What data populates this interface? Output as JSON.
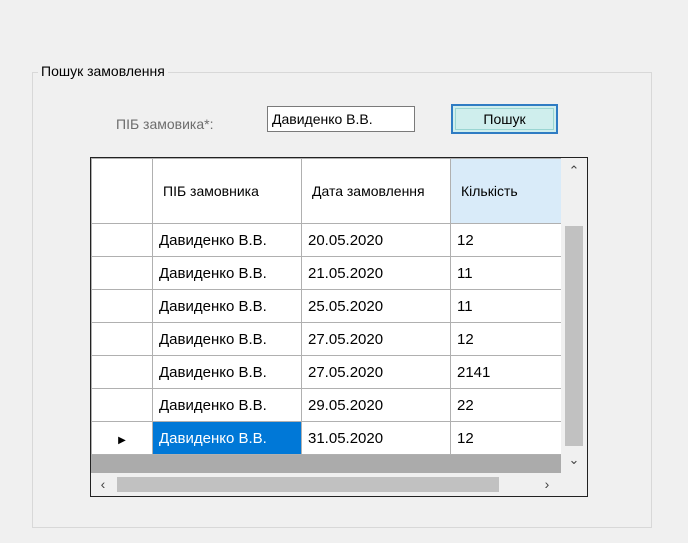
{
  "groupbox": {
    "title": "Пошук замовлення"
  },
  "search": {
    "label": "ПІБ замовика*:",
    "value": "Давиденко В.В.",
    "button_label": "Пошук"
  },
  "grid": {
    "columns": [
      "ПІБ замовника",
      "Дата замовлення",
      "Кількість"
    ],
    "rows": [
      [
        "Давиденко В.В.",
        "20.05.2020",
        "12"
      ],
      [
        "Давиденко В.В.",
        "21.05.2020",
        "11"
      ],
      [
        "Давиденко В.В.",
        "25.05.2020",
        "11"
      ],
      [
        "Давиденко В.В.",
        "27.05.2020",
        "12"
      ],
      [
        "Давиденко В.В.",
        "27.05.2020",
        "2141"
      ],
      [
        "Давиденко В.В.",
        "29.05.2020",
        "22"
      ],
      [
        "Давиденко В.В.",
        "31.05.2020",
        "12"
      ]
    ],
    "selected_row": 6,
    "current_row_marker": "▶"
  },
  "icons": {
    "scroll_up": "chevron-up-icon",
    "scroll_down": "chevron-down-icon",
    "scroll_left": "chevron-left-icon",
    "scroll_right": "chevron-right-icon"
  },
  "colors": {
    "selection": "#0078d7",
    "button_border": "#2f7cc3",
    "button_fill": "#cfeeed",
    "header_sorted": "#d9ebf9"
  }
}
